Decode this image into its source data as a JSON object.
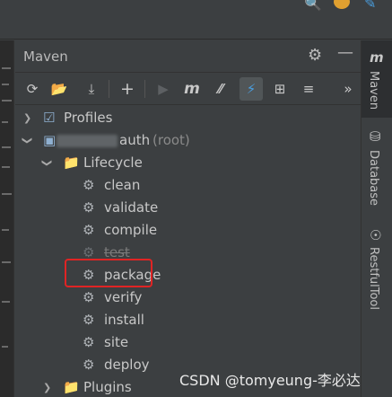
{
  "panel": {
    "title": "Maven"
  },
  "toolbar": {
    "buttons": [
      {
        "icon": "reload-icon"
      },
      {
        "icon": "generate-sources-icon"
      },
      {
        "icon": "download-icon"
      },
      {
        "icon": "add-icon",
        "label": "+"
      },
      {
        "icon": "run-icon"
      },
      {
        "icon": "execute-goal-icon",
        "label": "m"
      },
      {
        "icon": "toggle-offline-icon"
      },
      {
        "icon": "skip-tests-icon"
      },
      {
        "icon": "show-dependencies-icon"
      },
      {
        "icon": "collapse-all-icon"
      }
    ],
    "more_label": "»"
  },
  "tree": {
    "profiles": "Profiles",
    "root_name": "auth",
    "root_suffix": "(root)",
    "lifecycle": "Lifecycle",
    "goals": [
      "clean",
      "validate",
      "compile",
      "test",
      "package",
      "verify",
      "install",
      "site",
      "deploy"
    ],
    "skipped_goal": "test",
    "plugins": "Plugins"
  },
  "right_strip": {
    "tabs": [
      {
        "label": "Maven",
        "icon": "maven-icon"
      },
      {
        "label": "Database",
        "icon": "database-icon"
      },
      {
        "label": "RestfulTool",
        "icon": "restful-tool-icon"
      }
    ]
  },
  "watermark": "CSDN @tomyeung-李必达",
  "colors": {
    "background": "#3c3f41",
    "highlight_box": "#e02424",
    "selected_tool": "#515658"
  }
}
